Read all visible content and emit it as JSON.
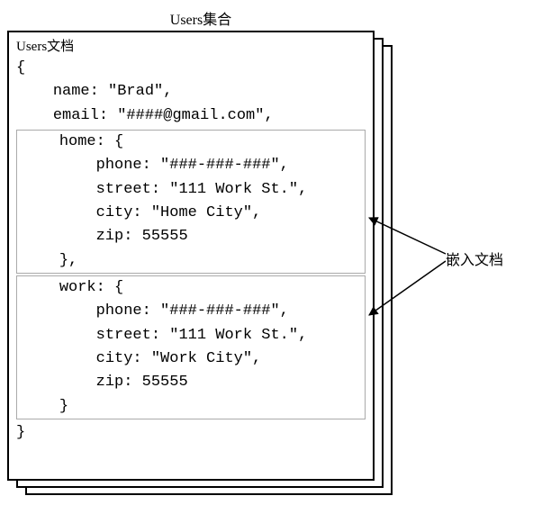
{
  "title": "Users集合",
  "doc_label": "Users文档",
  "annotation": "嵌入文档",
  "root": {
    "open": "{",
    "close": "}",
    "line1_key": "name: ",
    "line1_val": "\"Brad\",",
    "line2_key": "email: ",
    "line2_val": "\"####@gmail.com\","
  },
  "home": {
    "open_key": "home: ",
    "open_brace": "{",
    "phone_key": "phone: ",
    "phone_val": "\"###-###-###\",",
    "street_key": "street: ",
    "street_val": "\"111 Work St.\",",
    "city_key": "city: ",
    "city_val": "\"Home City\",",
    "zip_key": "zip: ",
    "zip_val": "55555",
    "close": "},"
  },
  "work": {
    "open_key": "work: ",
    "open_brace": "{",
    "phone_key": "phone: ",
    "phone_val": "\"###-###-###\",",
    "street_key": "street: ",
    "street_val": "\"111 Work St.\",",
    "city_key": "city: ",
    "city_val": "\"Work City\",",
    "zip_key": "zip: ",
    "zip_val": "55555",
    "close": "}"
  }
}
